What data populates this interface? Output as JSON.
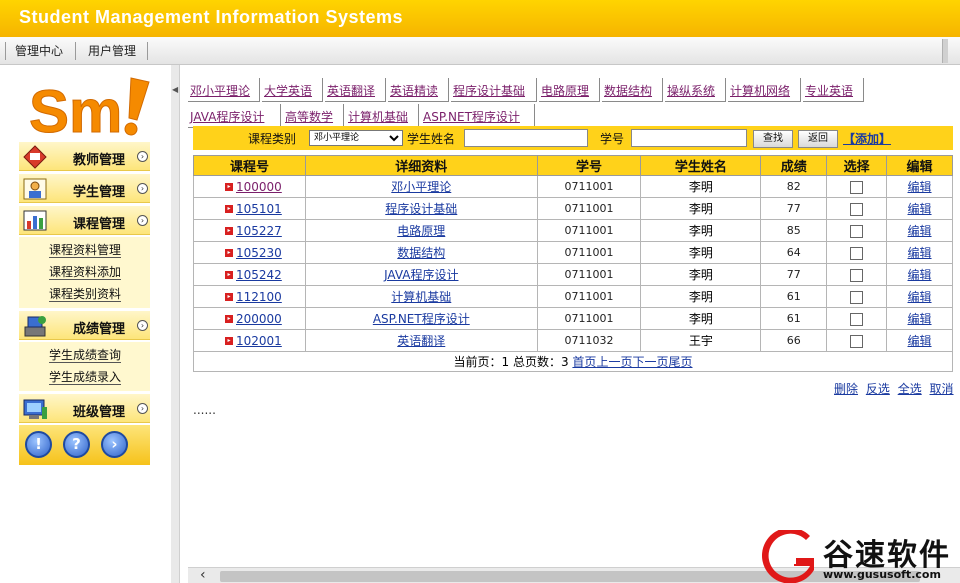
{
  "app": {
    "title": "Student Management Information Systems"
  },
  "top_nav": {
    "items": [
      "管理中心",
      "用户管理"
    ]
  },
  "sidebar": {
    "menus": [
      {
        "label": "教师管理",
        "icon": "teacher-icon"
      },
      {
        "label": "学生管理",
        "icon": "student-icon"
      },
      {
        "label": "课程管理",
        "icon": "course-icon",
        "items": [
          "课程资料管理",
          "课程资料添加",
          "课程类别资料"
        ]
      },
      {
        "label": "成绩管理",
        "icon": "grades-icon",
        "items": [
          "学生成绩查询",
          "学生成绩录入"
        ]
      },
      {
        "label": "班级管理",
        "icon": "class-icon"
      }
    ],
    "bottom_icons": [
      "info-icon",
      "help-icon",
      "forward-icon"
    ]
  },
  "course_tabs": {
    "row1": [
      "邓小平理论",
      "大学英语",
      "英语翻译",
      "英语精读",
      "程序设计基础",
      "电路原理",
      "数据结构",
      "操纵系统",
      "计算机网络",
      "专业英语"
    ],
    "row2": [
      "JAVA程序设计",
      "高等数学",
      "计算机基础",
      "ASP.NET程序设计"
    ]
  },
  "search": {
    "category_label": "课程类别",
    "category_value": "邓小平理论",
    "name_label": "学生姓名",
    "id_label": "学号",
    "search_button": "查找",
    "back_button": "返回",
    "add_link": "【添加】"
  },
  "table": {
    "headers": [
      "课程号",
      "详细资料",
      "学号",
      "学生姓名",
      "成绩",
      "选择",
      "编辑"
    ],
    "rows": [
      {
        "code": "100000",
        "course": "邓小平理论",
        "student_id": "0711001",
        "name": "李明",
        "score": "82",
        "edit": "编辑"
      },
      {
        "code": "105101",
        "course": "程序设计基础",
        "student_id": "0711001",
        "name": "李明",
        "score": "77",
        "edit": "编辑"
      },
      {
        "code": "105227",
        "course": "电路原理",
        "student_id": "0711001",
        "name": "李明",
        "score": "85",
        "edit": "编辑"
      },
      {
        "code": "105230",
        "course": "数据结构",
        "student_id": "0711001",
        "name": "李明",
        "score": "64",
        "edit": "编辑"
      },
      {
        "code": "105242",
        "course": "JAVA程序设计",
        "student_id": "0711001",
        "name": "李明",
        "score": "77",
        "edit": "编辑"
      },
      {
        "code": "112100",
        "course": "计算机基础",
        "student_id": "0711001",
        "name": "李明",
        "score": "61",
        "edit": "编辑"
      },
      {
        "code": "200000",
        "course": "ASP.NET程序设计",
        "student_id": "0711001",
        "name": "李明",
        "score": "61",
        "edit": "编辑"
      },
      {
        "code": "102001",
        "course": "英语翻译",
        "student_id": "0711032",
        "name": "王宇",
        "score": "66",
        "edit": "编辑"
      }
    ],
    "pager": {
      "text": "当前页：1 总页数：3",
      "first": "首页",
      "prev": "上一页",
      "next": "下一页",
      "last": "尾页"
    }
  },
  "bulk_actions": [
    "删除",
    "反选",
    "全选",
    "取消"
  ],
  "ellipsis": "......",
  "watermark": {
    "name": "谷速软件",
    "url": "www.gususoft.com"
  }
}
